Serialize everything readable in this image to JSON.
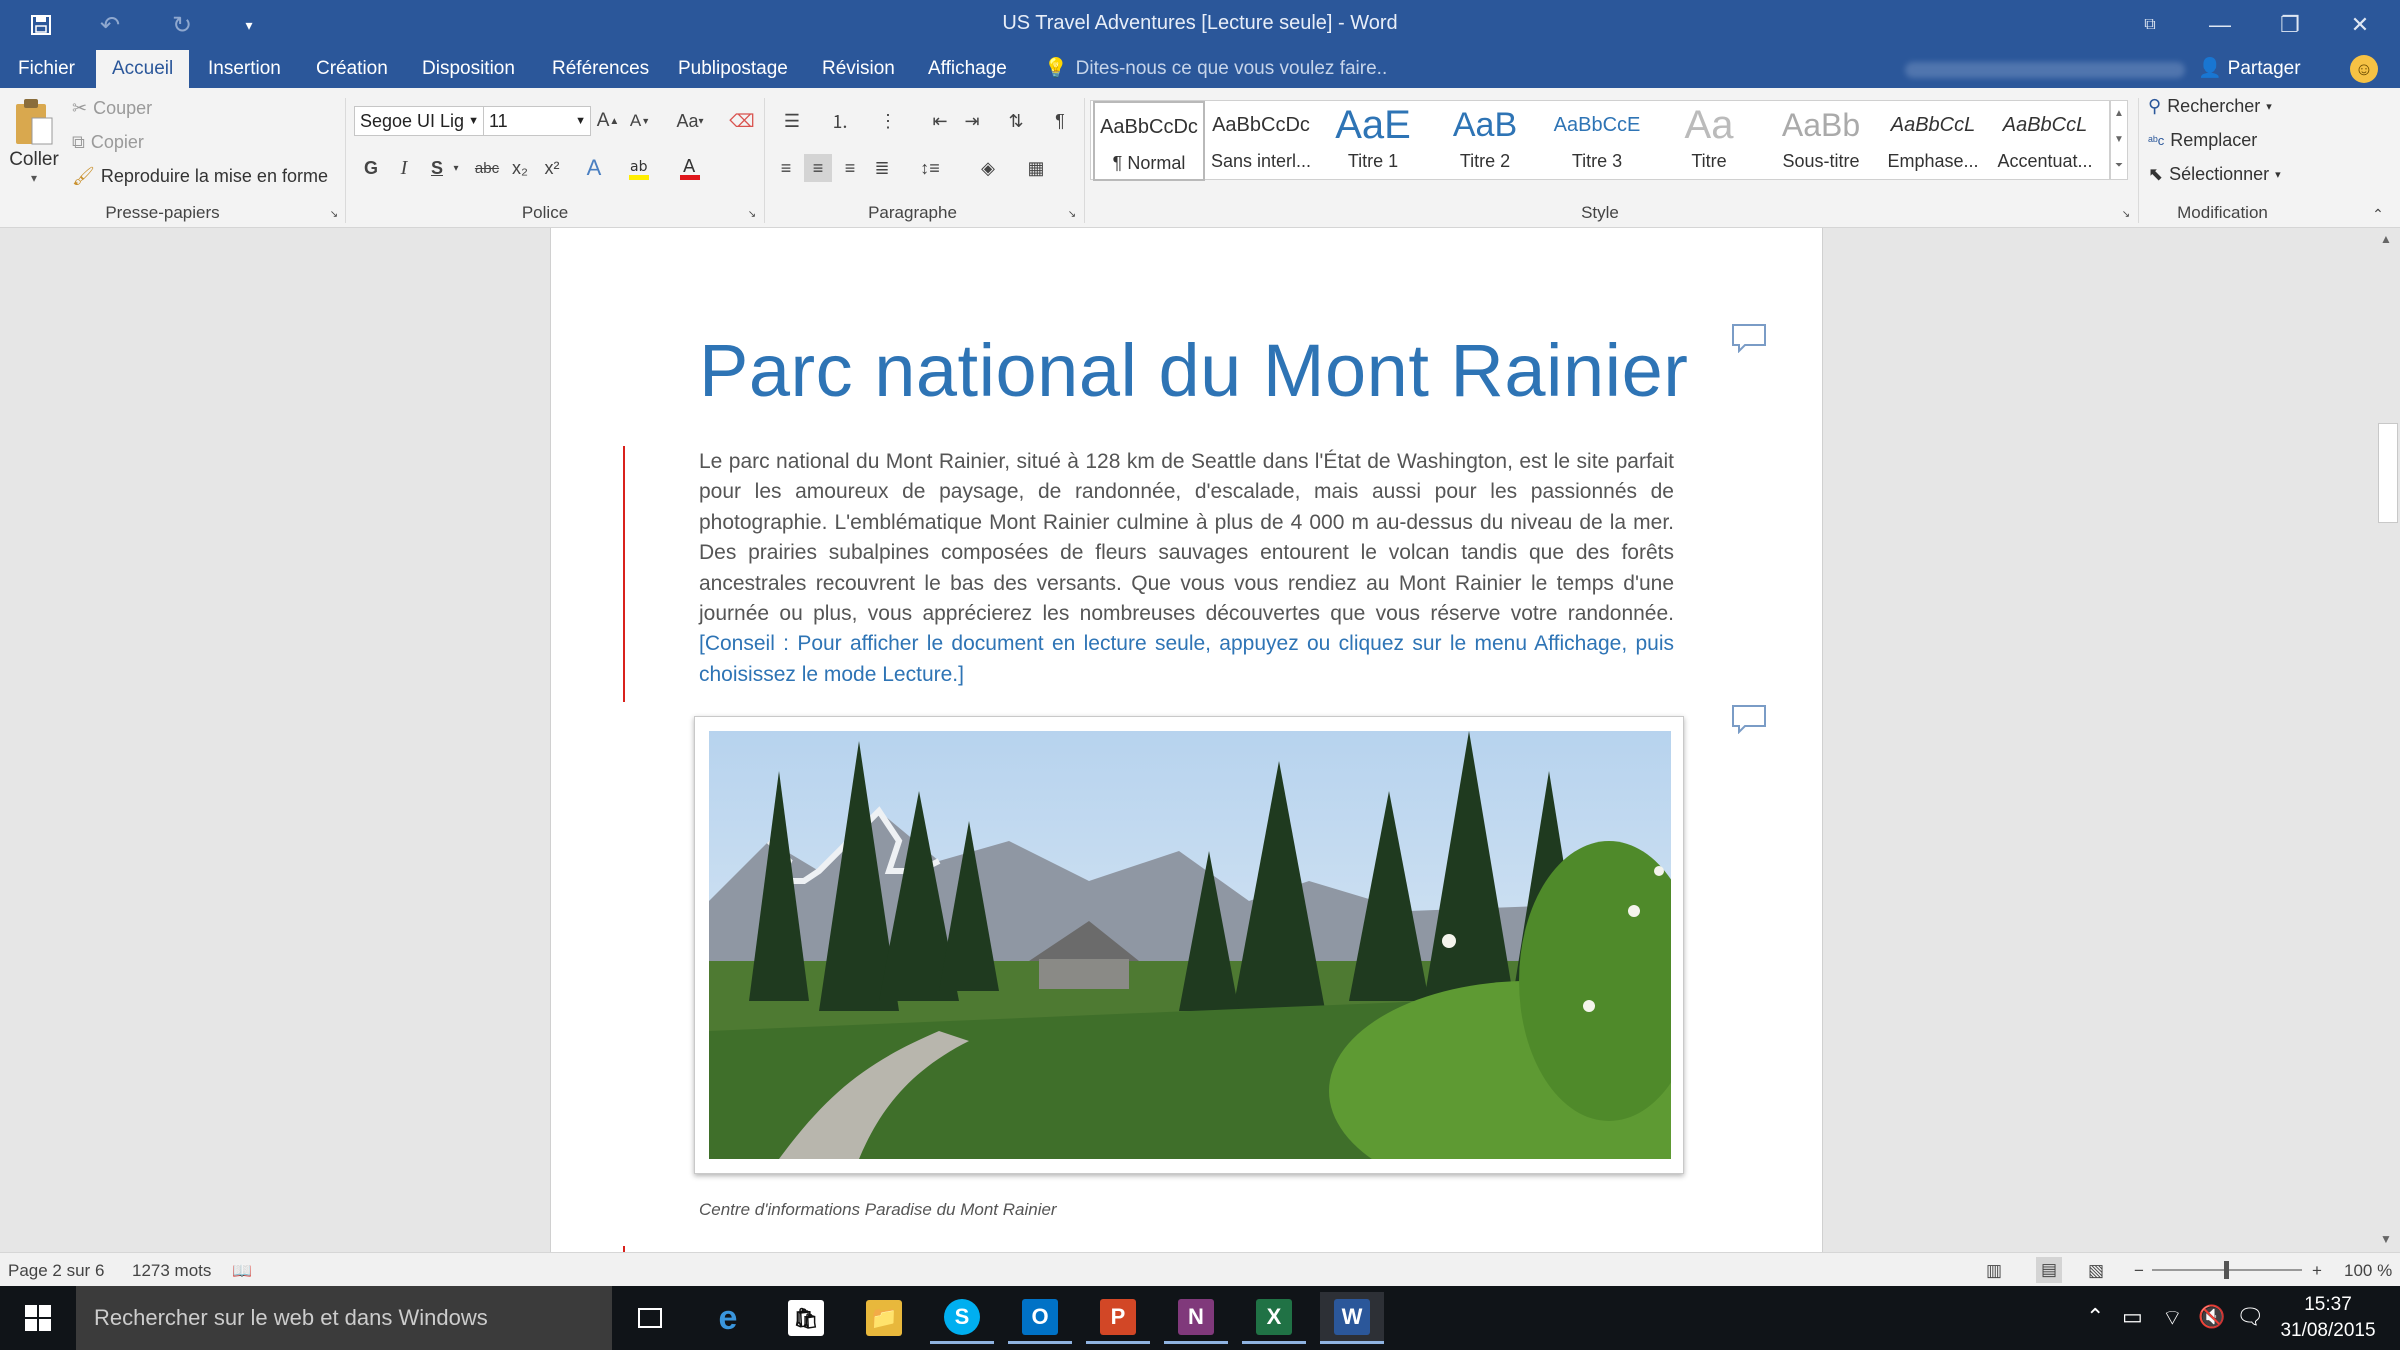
{
  "window": {
    "title": "US Travel Adventures [Lecture seule] - Word",
    "minimize": "—",
    "restore": "❐",
    "close": "✕"
  },
  "tabs": [
    "Fichier",
    "Accueil",
    "Insertion",
    "Création",
    "Disposition",
    "Références",
    "Publipostage",
    "Révision",
    "Affichage"
  ],
  "tell_me": "Dites-nous ce que vous voulez faire..",
  "share": "Partager",
  "ribbon": {
    "clipboard": {
      "label": "Presse-papiers",
      "paste": "Coller",
      "cut": "Couper",
      "copy": "Copier",
      "format_painter": "Reproduire la mise en forme"
    },
    "font": {
      "label": "Police",
      "font_name": "Segoe UI Lig",
      "font_size": "11",
      "bold": "G",
      "italic": "I",
      "underline": "S",
      "strike": "abc",
      "subscript": "x₂",
      "superscript": "x²",
      "grow": "A",
      "shrink": "A",
      "case": "Aa"
    },
    "paragraph": {
      "label": "Paragraphe"
    },
    "styles": {
      "label": "Style",
      "items": [
        {
          "preview": "AaBbCcDc",
          "name": "¶ Normal"
        },
        {
          "preview": "AaBbCcDc",
          "name": "Sans interl..."
        },
        {
          "preview": "AaE",
          "name": "Titre 1"
        },
        {
          "preview": "AaB",
          "name": "Titre 2"
        },
        {
          "preview": "AaBbCcE",
          "name": "Titre 3"
        },
        {
          "preview": "Aa",
          "name": "Titre"
        },
        {
          "preview": "AaBb",
          "name": "Sous-titre"
        },
        {
          "preview": "AaBbCcL",
          "name": "Emphase..."
        },
        {
          "preview": "AaBbCcL",
          "name": "Accentuat..."
        }
      ]
    },
    "editing": {
      "label": "Modification",
      "find": "Rechercher",
      "replace": "Remplacer",
      "select": "Sélectionner"
    }
  },
  "document": {
    "heading": "Parc national du Mont Rainier",
    "body": "Le parc national du Mont Rainier, situé à 128 km de Seattle dans l'État de Washington, est le site parfait pour les amoureux de paysage, de randonnée, d'escalade, mais aussi pour les passionnés de photographie. L'emblématique Mont Rainier culmine à plus de 4 000 m au-dessus du niveau de la mer. Des prairies subalpines composées de fleurs sauvages entourent le volcan tandis que des forêts ancestrales recouvrent le bas des versants. Que vous vous rendiez au Mont Rainier le temps d'une journée ou plus, vous apprécierez les nombreuses découvertes que vous réserve votre randonnée.",
    "tip": "[Conseil : Pour afficher le document en lecture seule, appuyez ou cliquez sur le menu Affichage, puis choisissez le mode Lecture.]",
    "caption": "Centre d'informations Paradise du Mont Rainier"
  },
  "status": {
    "page": "Page 2 sur 6",
    "words": "1273 mots",
    "zoom": "100 %"
  },
  "taskbar": {
    "search": "Rechercher sur le web et dans Windows",
    "time": "15:37",
    "date": "31/08/2015"
  },
  "colors": {
    "brand": "#2b579a",
    "heading": "#2e74b5",
    "revision_bar": "#d9211c"
  }
}
